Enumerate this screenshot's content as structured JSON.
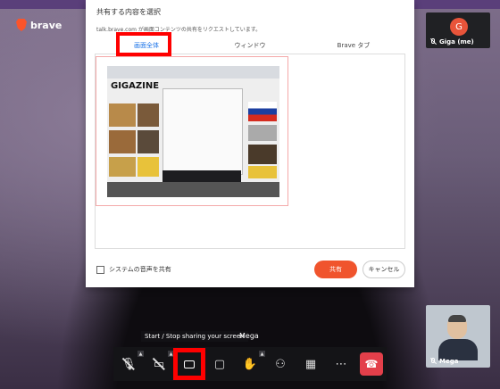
{
  "browser": {
    "brand": "brave"
  },
  "dialog": {
    "title": "共有する内容を選択",
    "subtitle": "talk.brave.com が画面コンテンツの共有をリクエストしています。",
    "tabs": [
      {
        "label": "画面全体",
        "active": true
      },
      {
        "label": "ウィンドウ",
        "active": false
      },
      {
        "label": "Brave タブ",
        "active": false
      }
    ],
    "system_audio_label": "システムの音声を共有",
    "share_button": "共有",
    "cancel_button": "キャンセル",
    "thumbnail_logo": "GIGAZINE"
  },
  "participants": [
    {
      "name": "Giga (me)",
      "initial": "G",
      "muted": true
    },
    {
      "name": "Mega",
      "muted": true
    }
  ],
  "speaker_label": "Mega",
  "tooltip": "Start / Stop sharing your screen",
  "colors": {
    "accent": "#1a73e8",
    "share": "#f0542d",
    "hangup": "#e33f4a",
    "highlight": "#ff0000"
  }
}
